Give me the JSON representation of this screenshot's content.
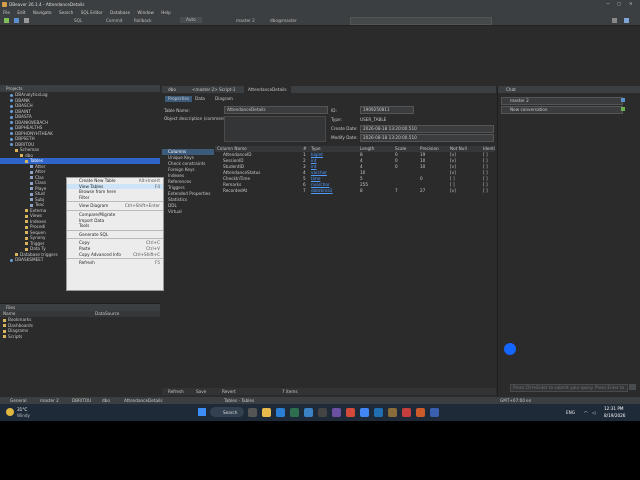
{
  "window": {
    "title": "DBeaver 26.1.4 - AttendanceDetails"
  },
  "menu": [
    "File",
    "Edit",
    "Navigate",
    "Search",
    "SQL Editor",
    "Database",
    "Window",
    "Help"
  ],
  "toolbar": {
    "sql": "SQL",
    "commit": "Commit",
    "rollback": "Rollback",
    "auto": "Auto",
    "conn": "master 2",
    "schema": "dbo@master",
    "search_hint": ""
  },
  "tabs": {
    "dbo": "dbo",
    "master2": "<master 2> Script-1",
    "attendance": "AttendanceDetails"
  },
  "projects": {
    "title": "Projects",
    "items": [
      {
        "label": "DBAnalyticsLog",
        "depth": 2,
        "kind": "db"
      },
      {
        "label": "DBANK",
        "depth": 2,
        "kind": "db"
      },
      {
        "label": "DBASCH",
        "depth": 2,
        "kind": "db"
      },
      {
        "label": "DBAINT",
        "depth": 2,
        "kind": "db"
      },
      {
        "label": "DBASTA",
        "depth": 2,
        "kind": "db"
      },
      {
        "label": "DBANKWEBACH",
        "depth": 2,
        "kind": "db"
      },
      {
        "label": "DBPHEALTHS",
        "depth": 2,
        "kind": "db"
      },
      {
        "label": "DBPHONYHTHEAK",
        "depth": 2,
        "kind": "db"
      },
      {
        "label": "DBPSETH",
        "depth": 2,
        "kind": "db"
      },
      {
        "label": "DBRITOU",
        "depth": 2,
        "kind": "db"
      },
      {
        "label": "Schemas",
        "depth": 3,
        "kind": "folder"
      },
      {
        "label": "dbo",
        "depth": 4,
        "kind": "folder"
      },
      {
        "label": "Tables",
        "depth": 5,
        "kind": "folder"
      },
      {
        "label": "Atter",
        "depth": 6,
        "kind": "tb"
      },
      {
        "label": "Atter",
        "depth": 6,
        "kind": "tb"
      },
      {
        "label": "Clas",
        "depth": 6,
        "kind": "tb"
      },
      {
        "label": "Class",
        "depth": 6,
        "kind": "tb"
      },
      {
        "label": "Playe",
        "depth": 6,
        "kind": "tb"
      },
      {
        "label": "Stud",
        "depth": 6,
        "kind": "tb"
      },
      {
        "label": "Subj",
        "depth": 6,
        "kind": "tb"
      },
      {
        "label": "Teac",
        "depth": 6,
        "kind": "tb"
      },
      {
        "label": "Externa",
        "depth": 5,
        "kind": "folder"
      },
      {
        "label": "Views",
        "depth": 5,
        "kind": "folder"
      },
      {
        "label": "Indexes",
        "depth": 5,
        "kind": "folder"
      },
      {
        "label": "Procedi",
        "depth": 5,
        "kind": "folder"
      },
      {
        "label": "Sequen",
        "depth": 5,
        "kind": "folder"
      },
      {
        "label": "Synony",
        "depth": 5,
        "kind": "folder"
      },
      {
        "label": "Trigger",
        "depth": 5,
        "kind": "folder"
      },
      {
        "label": "Data Ty",
        "depth": 5,
        "kind": "folder"
      },
      {
        "label": "Database triggers",
        "depth": 3,
        "kind": "folder"
      },
      {
        "label": "DBASKSMEET",
        "depth": 2,
        "kind": "db"
      }
    ]
  },
  "context_menu": [
    {
      "label": "Create New Table",
      "shortcut": "Alt+Insert"
    },
    {
      "label": "View Tables",
      "shortcut": "F4",
      "highlight": true
    },
    {
      "label": "Browse from here",
      "shortcut": ""
    },
    {
      "label": "Filter",
      "shortcut": ""
    },
    {
      "sep": true
    },
    {
      "label": "View Diagram",
      "shortcut": "Ctrl+Shift+Enter"
    },
    {
      "sep": true
    },
    {
      "label": "Compare/Migrate",
      "shortcut": ""
    },
    {
      "label": "Import Data",
      "shortcut": ""
    },
    {
      "label": "Tools",
      "shortcut": ""
    },
    {
      "sep": true
    },
    {
      "label": "Generate SQL",
      "shortcut": ""
    },
    {
      "sep": true
    },
    {
      "label": "Copy",
      "shortcut": "Ctrl+C"
    },
    {
      "label": "Paste",
      "shortcut": "Ctrl+V"
    },
    {
      "label": "Copy Advanced Info",
      "shortcut": "Ctrl+Shift+C"
    },
    {
      "sep": true
    },
    {
      "label": "Refresh",
      "shortcut": "F5"
    }
  ],
  "files": {
    "title": "Files",
    "col1": "Name",
    "col2": "DataSource",
    "items": [
      "Bookmarks",
      "Dashboards",
      "Diagrams",
      "Scripts"
    ]
  },
  "editor": {
    "subtabs": [
      "Properties",
      "Data",
      "Diagram"
    ],
    "table_name_label": "Table Name:",
    "table_name": "AttendanceDetails",
    "desc_label": "Object description (comment):",
    "id_label": "ID:",
    "id_value": "1909250811",
    "type_label": "Type:",
    "type_value": "USER_TABLE",
    "create_label": "Create Date:",
    "create_value": "2026-08-18 13:20:00.510",
    "modify_label": "Modify Date:",
    "modify_value": "2026-08-18 13:20:00.510",
    "side_items": [
      "Columns",
      "Unique Keys",
      "Check constraints",
      "Foreign Keys",
      "Indexes",
      "References",
      "Triggers",
      "Extended Properties",
      "Statistics",
      "DDL",
      "Virtual"
    ],
    "grid_headers": [
      "Column Name",
      "#",
      "Type",
      "Length",
      "Scale",
      "Precision",
      "Not Null",
      "Identi"
    ],
    "rows": [
      {
        "name": "AttendanceID",
        "n": "1",
        "type": "bigint",
        "len": "8",
        "scale": "0",
        "prec": "19",
        "nn": "[v]",
        "id": "[ ]"
      },
      {
        "name": "SessionID",
        "n": "2",
        "type": "int",
        "len": "4",
        "scale": "0",
        "prec": "10",
        "nn": "[v]",
        "id": "[ ]"
      },
      {
        "name": "StudentID",
        "n": "3",
        "type": "int",
        "len": "4",
        "scale": "0",
        "prec": "10",
        "nn": "[v]",
        "id": "[ ]"
      },
      {
        "name": "AttendanceStatus",
        "n": "4",
        "type": "varchar",
        "len": "10",
        "scale": "",
        "prec": "",
        "nn": "[v]",
        "id": "[ ]"
      },
      {
        "name": "CheckInTime",
        "n": "5",
        "type": "time",
        "len": "5",
        "scale": "",
        "prec": "0",
        "nn": "[ ]",
        "id": "[ ]"
      },
      {
        "name": "Remarks",
        "n": "6",
        "type": "nvarchar",
        "len": "255",
        "scale": "",
        "prec": "",
        "nn": "[ ]",
        "id": "[ ]"
      },
      {
        "name": "RecordedAt",
        "n": "7",
        "type": "datetime2",
        "len": "8",
        "scale": "7",
        "prec": "27",
        "nn": "[v]",
        "id": "[ ]"
      }
    ],
    "bottom": {
      "refresh": "Refresh",
      "save": "Save",
      "revert": "Revert",
      "items": "7 items"
    }
  },
  "chat": {
    "title": "Chat",
    "conn": "master 2",
    "new": "New conversation",
    "placeholder": "Press Ctrl+Enter to submit your query. Press Enter to"
  },
  "status": {
    "general": "General",
    "master": "master 2",
    "dbritou": "DBRITOU",
    "dbo": "dbo",
    "table": "AttendanceDetails",
    "center": "Tables - Tables",
    "tz": "GMT+07:00",
    "lang": "en"
  },
  "taskbar": {
    "weather_temp": "31°C",
    "weather_desc": "Windy",
    "search": "Search",
    "lang": "ENG",
    "time": "12:31 PM",
    "date": "8/19/2026"
  }
}
